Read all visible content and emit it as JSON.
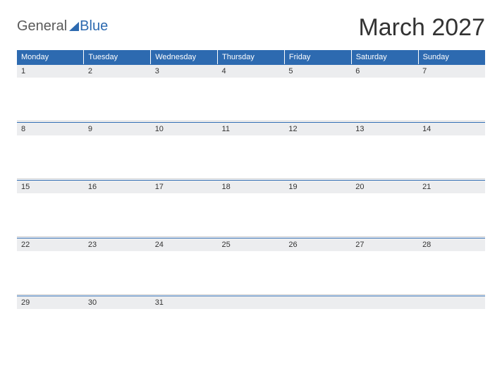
{
  "logo": {
    "word1": "General",
    "word2": "Blue"
  },
  "title": "March 2027",
  "daysOfWeek": [
    "Monday",
    "Tuesday",
    "Wednesday",
    "Thursday",
    "Friday",
    "Saturday",
    "Sunday"
  ],
  "weeks": [
    [
      "1",
      "2",
      "3",
      "4",
      "5",
      "6",
      "7"
    ],
    [
      "8",
      "9",
      "10",
      "11",
      "12",
      "13",
      "14"
    ],
    [
      "15",
      "16",
      "17",
      "18",
      "19",
      "20",
      "21"
    ],
    [
      "22",
      "23",
      "24",
      "25",
      "26",
      "27",
      "28"
    ],
    [
      "29",
      "30",
      "31",
      "",
      "",
      "",
      ""
    ]
  ]
}
